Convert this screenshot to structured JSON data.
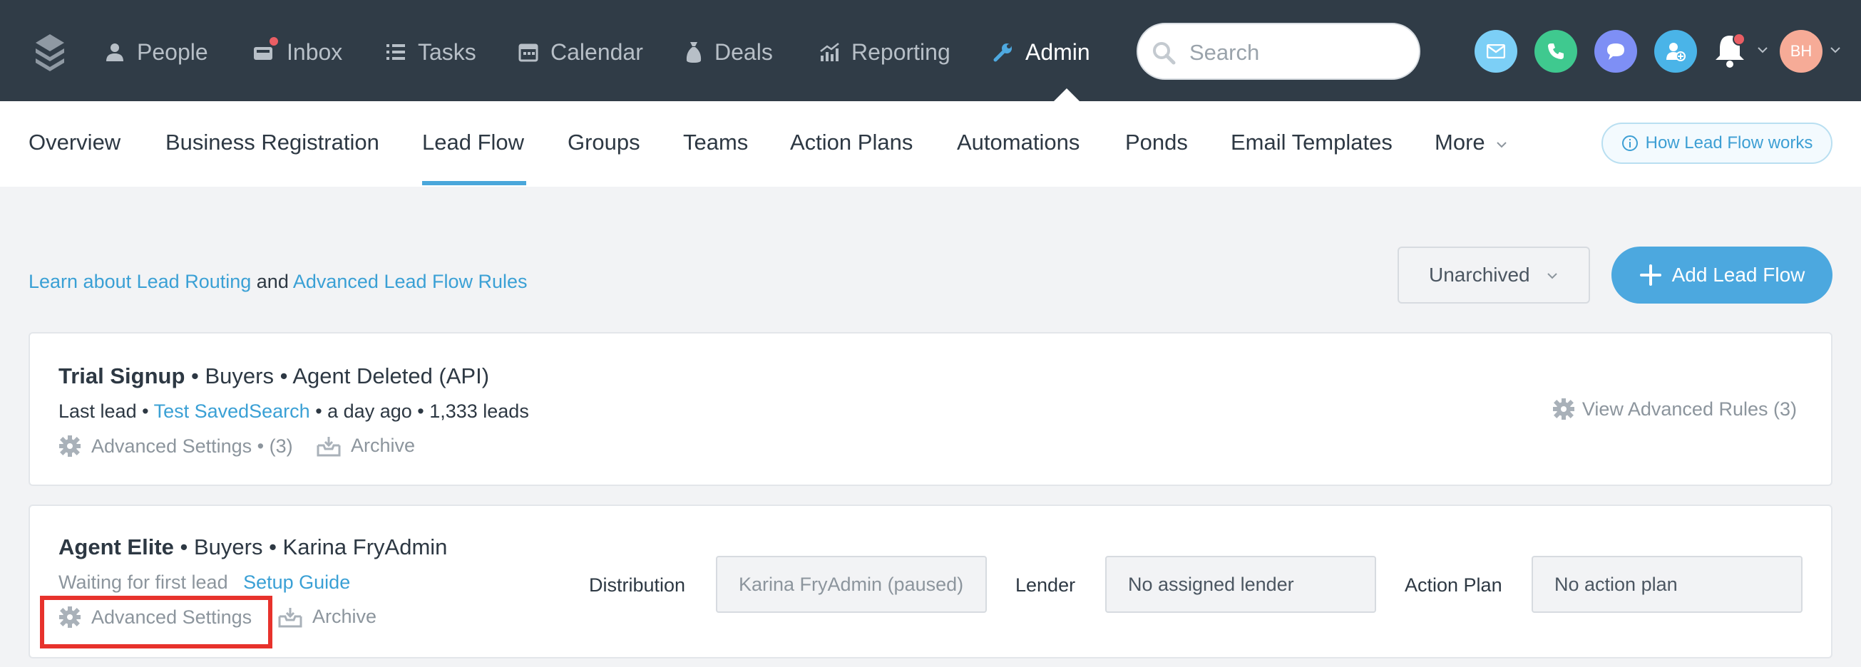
{
  "topnav": {
    "items": [
      {
        "label": "People",
        "icon": "person-icon"
      },
      {
        "label": "Inbox",
        "icon": "inbox-icon",
        "has_notification": true
      },
      {
        "label": "Tasks",
        "icon": "list-icon"
      },
      {
        "label": "Calendar",
        "icon": "calendar-icon"
      },
      {
        "label": "Deals",
        "icon": "money-bag-icon"
      },
      {
        "label": "Reporting",
        "icon": "chart-icon"
      },
      {
        "label": "Admin",
        "icon": "wrench-icon",
        "active": true
      }
    ],
    "search_placeholder": "Search",
    "avatar_initials": "BH",
    "action_colors": {
      "email": "#7ccff6",
      "phone": "#3fc98f",
      "chat": "#7e8ff5",
      "add_contact": "#4ab4e8"
    }
  },
  "subnav": {
    "tabs": [
      "Overview",
      "Business Registration",
      "Lead Flow",
      "Groups",
      "Teams",
      "Action Plans",
      "Automations",
      "Ponds",
      "Email Templates",
      "More"
    ],
    "active_tab": "Lead Flow",
    "help_button": "How Lead Flow works"
  },
  "controls": {
    "learn_link_1": "Learn about Lead Routing",
    "learn_and": "and",
    "learn_link_2": "Advanced Lead Flow Rules",
    "filter_value": "Unarchived",
    "add_button": "Add Lead Flow"
  },
  "cards": [
    {
      "title": "Trial Signup",
      "subtitle": " • Buyers • Agent Deleted (API)",
      "meta_prefix": "Last lead • ",
      "meta_link": "Test SavedSearch",
      "meta_suffix": " • a day ago • 1,333 leads",
      "settings_label": "Advanced Settings • (3)",
      "archive_label": "Archive",
      "view_rules": "View Advanced Rules (3)"
    },
    {
      "title": "Agent Elite",
      "subtitle": " • Buyers • Karina FryAdmin",
      "meta_text": "Waiting for first lead",
      "meta_link": "Setup Guide",
      "settings_label": "Advanced Settings",
      "archive_label": "Archive",
      "distribution_label": "Distribution",
      "distribution_value": "Karina FryAdmin (paused)",
      "lender_label": "Lender",
      "lender_value": "No assigned lender",
      "action_plan_label": "Action Plan",
      "action_plan_value": "No action plan"
    }
  ]
}
